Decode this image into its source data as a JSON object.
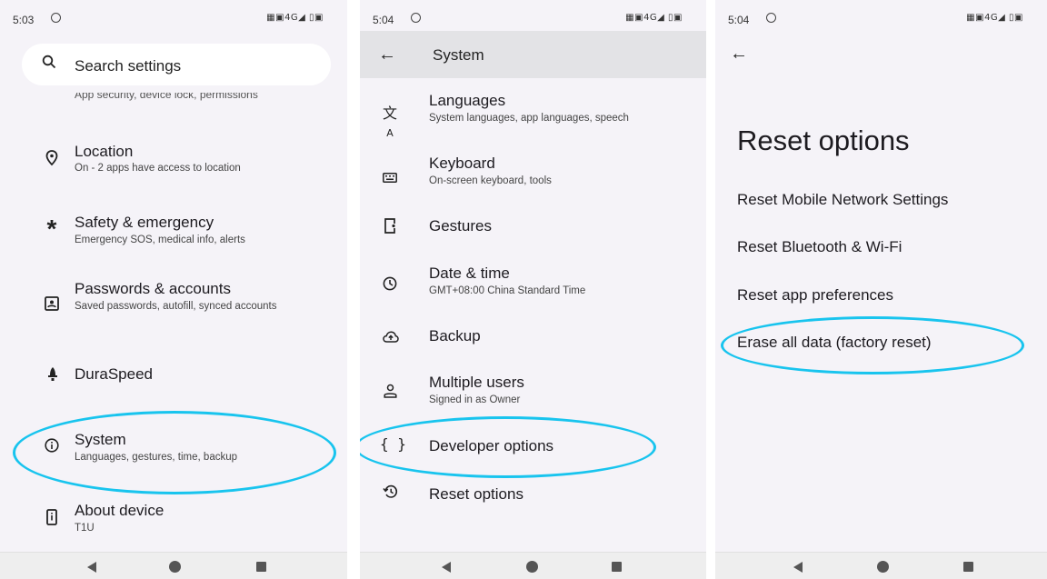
{
  "screen1": {
    "status": {
      "time": "5:03",
      "icons": "▦▣4G◢ ▯▣"
    },
    "search": {
      "placeholder": "Search settings"
    },
    "clipped_text": "App security, device lock, permissions",
    "items": [
      {
        "icon": "location-pin-icon",
        "title": "Location",
        "subtitle": "On - 2 apps have access to location"
      },
      {
        "icon": "asterisk-icon",
        "title": "Safety & emergency",
        "subtitle": "Emergency SOS, medical info, alerts"
      },
      {
        "icon": "account-box-icon",
        "title": "Passwords & accounts",
        "subtitle": "Saved passwords, autofill, synced accounts"
      },
      {
        "icon": "rocket-icon",
        "title": "DuraSpeed",
        "subtitle": ""
      },
      {
        "icon": "info-icon",
        "title": "System",
        "subtitle": "Languages, gestures, time, backup"
      },
      {
        "icon": "device-info-icon",
        "title": "About device",
        "subtitle": "T1U"
      }
    ]
  },
  "screen2": {
    "status": {
      "time": "5:04",
      "icons": "▦▣4G◢ ▯▣"
    },
    "title": "System",
    "items": [
      {
        "icon": "translate-icon",
        "title": "Languages",
        "subtitle": "System languages, app languages, speech"
      },
      {
        "icon": "keyboard-icon",
        "title": "Keyboard",
        "subtitle": "On-screen keyboard, tools"
      },
      {
        "icon": "gestures-icon",
        "title": "Gestures",
        "subtitle": ""
      },
      {
        "icon": "clock-icon",
        "title": "Date & time",
        "subtitle": "GMT+08:00 China Standard Time"
      },
      {
        "icon": "cloud-upload-icon",
        "title": "Backup",
        "subtitle": ""
      },
      {
        "icon": "person-icon",
        "title": "Multiple users",
        "subtitle": "Signed in as Owner"
      },
      {
        "icon": "braces-icon",
        "title": "Developer options",
        "subtitle": ""
      },
      {
        "icon": "history-icon",
        "title": "Reset options",
        "subtitle": ""
      }
    ]
  },
  "screen3": {
    "status": {
      "time": "5:04",
      "icons": "▦▣4G◢ ▯▣"
    },
    "heading": "Reset options",
    "options": [
      "Reset Mobile Network Settings",
      "Reset Bluetooth & Wi-Fi",
      "Reset app preferences",
      "Erase all data (factory reset)"
    ]
  },
  "colors": {
    "highlight": "#18c4ee",
    "background": "#f5f3f8",
    "appbar": "#e3e3e6"
  }
}
